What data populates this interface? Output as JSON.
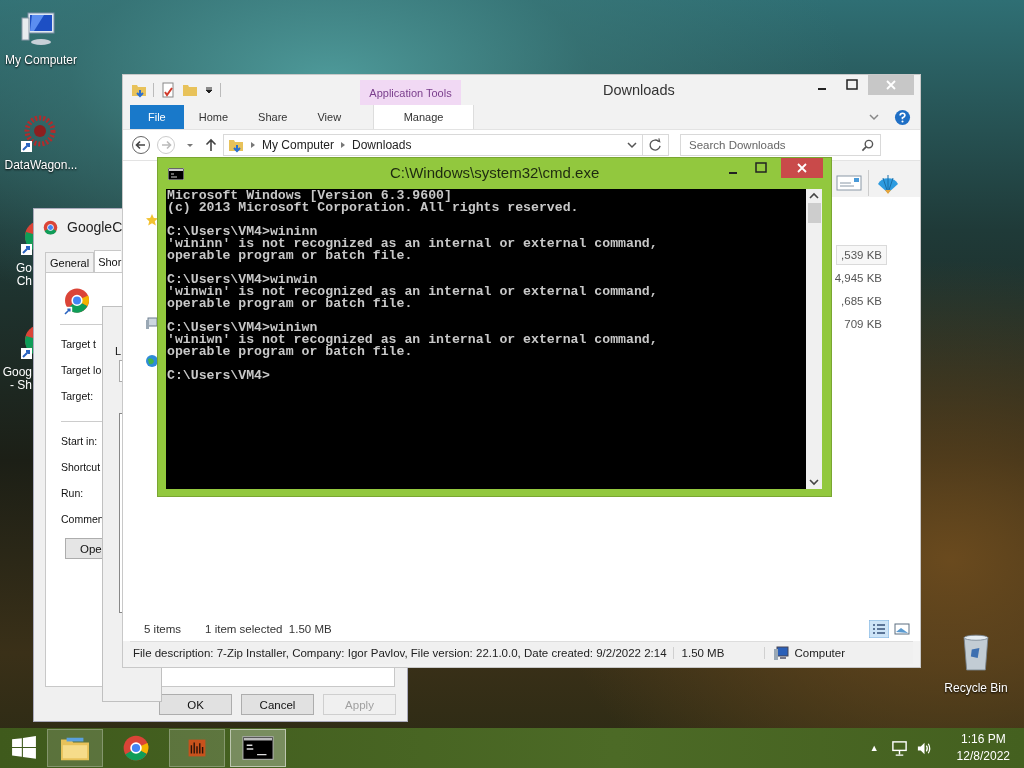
{
  "desktop_icons": [
    {
      "kind": "computer",
      "lines": [
        "My Computer"
      ]
    },
    {
      "kind": "datawagon",
      "lines": [
        "DataWagon..."
      ]
    },
    {
      "kind": "chrome",
      "lines": [
        "Go",
        "Ch"
      ]
    },
    {
      "kind": "chrome",
      "lines": [
        "Goog",
        "- Sh"
      ]
    }
  ],
  "recycle_bin": {
    "label": "Recycle Bin"
  },
  "properties_dialog": {
    "title": "GoogleC",
    "tabs": [
      {
        "label": "General",
        "selected": false
      },
      {
        "label": "Shor",
        "selected": true
      }
    ],
    "fields": [
      "Target t",
      "Target lo",
      "Target:",
      "Start in:",
      "Shortcut",
      "Run:",
      "Commen"
    ],
    "open_button": "Ope",
    "buttons": [
      {
        "label": "OK",
        "disabled": false
      },
      {
        "label": "Cancel",
        "disabled": false
      },
      {
        "label": "Apply",
        "disabled": true
      }
    ]
  },
  "inner_dialog": {
    "labels": [
      "L"
    ]
  },
  "explorer": {
    "title": "Downloads",
    "context_group": "Application Tools",
    "ribbon_tabs": [
      {
        "label": "File",
        "selected": true,
        "contextual": false
      },
      {
        "label": "Home",
        "selected": false,
        "contextual": false
      },
      {
        "label": "Share",
        "selected": false,
        "contextual": false
      },
      {
        "label": "View",
        "selected": false,
        "contextual": false
      },
      {
        "label": "Manage",
        "selected": false,
        "contextual": true
      }
    ],
    "breadcrumb": [
      "My Computer",
      "Downloads"
    ],
    "search": {
      "placeholder": "Search Downloads"
    },
    "sizes": [
      {
        "text": ",539 KB",
        "selected": true
      },
      {
        "text": "4,945 KB",
        "selected": false
      },
      {
        "text": ",685 KB",
        "selected": false
      },
      {
        "text": "709 KB",
        "selected": false
      }
    ],
    "status": {
      "items": "5 items",
      "selection": "1 item selected  1.50 MB"
    },
    "details": {
      "description": "File description: 7-Zip Installer, Company: Igor Pavlov, File version: 22.1.0.0, Date created: 9/2/2022 2:14",
      "size": "1.50 MB",
      "location": "Computer"
    }
  },
  "cmd": {
    "title": "C:\\Windows\\system32\\cmd.exe",
    "blocks": [
      [
        "Microsoft Windows [Version 6.3.9600]",
        "(c) 2013 Microsoft Corporation. All rights reserved."
      ],
      [
        "C:\\Users\\VM4>wininn",
        "'wininn' is not recognized as an internal or external command,",
        "operable program or batch file."
      ],
      [
        "C:\\Users\\VM4>winwin",
        "'winwin' is not recognized as an internal or external command,",
        "operable program or batch file."
      ],
      [
        "C:\\Users\\VM4>winiwn",
        "'winiwn' is not recognized as an internal or external command,",
        "operable program or batch file."
      ],
      [
        "C:\\Users\\VM4>"
      ]
    ]
  },
  "taskbar": {
    "apps": [
      {
        "kind": "explorer",
        "active": false
      },
      {
        "kind": "chrome",
        "active": false
      },
      {
        "kind": "app",
        "active": false
      },
      {
        "kind": "cmd",
        "active": true
      }
    ],
    "tray_expand": "▲",
    "time": "1:16 PM",
    "date": "12/8/2022"
  }
}
